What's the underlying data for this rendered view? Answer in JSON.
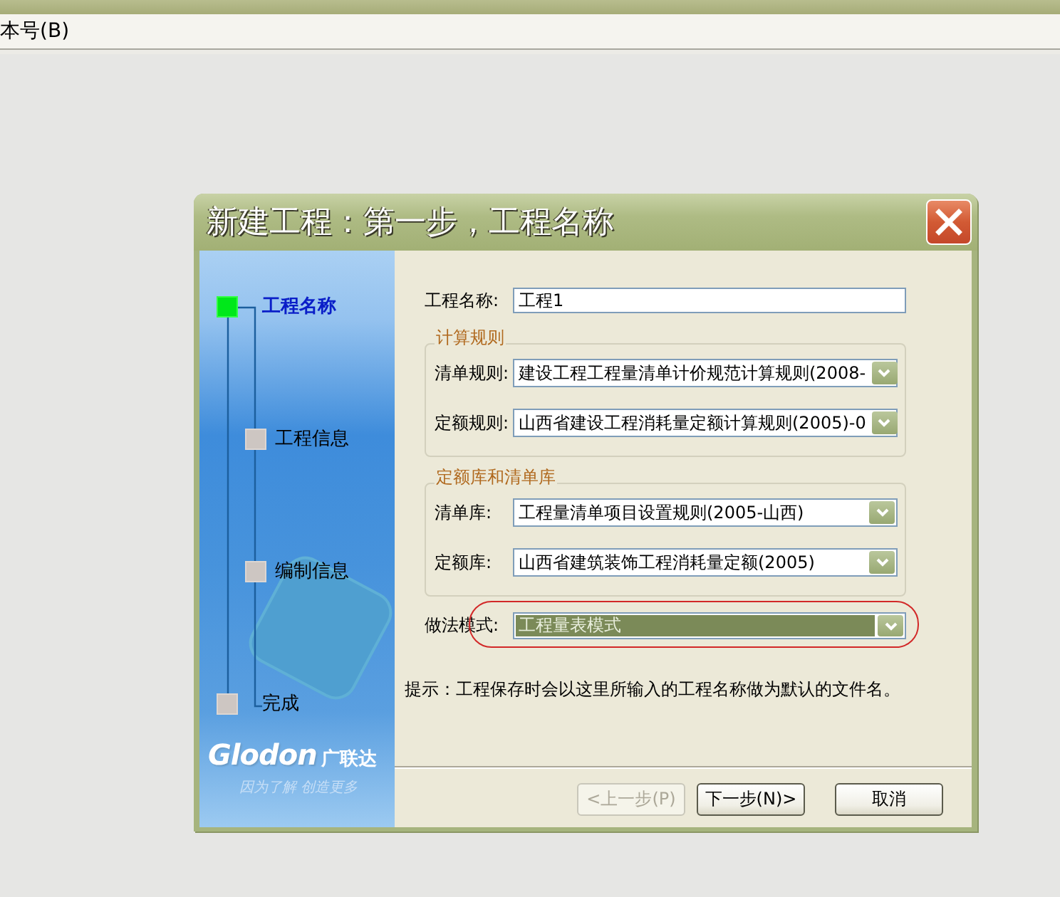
{
  "menu_bar": {
    "items": [
      {
        "label": "本号(B)"
      }
    ]
  },
  "dialog": {
    "title": "新建工程：第一步，工程名称",
    "steps": [
      {
        "label": "工程名称",
        "selected": true
      },
      {
        "label": "工程信息",
        "selected": false
      },
      {
        "label": "编制信息",
        "selected": false
      },
      {
        "label": "完成",
        "selected": false
      }
    ],
    "logo": {
      "brand": "Glodon",
      "brand_cn": "广联达",
      "tagline": "因为了解 创造更多"
    },
    "project_name": {
      "label": "工程名称:",
      "value": "工程1"
    },
    "groups": [
      {
        "legend": "计算规则",
        "fields": [
          {
            "label": "清单规则:",
            "value": "建设工程工程量清单计价规范计算规则(2008-",
            "highlighted": false
          },
          {
            "label": "定额规则:",
            "value": "山西省建设工程消耗量定额计算规则(2005)-0",
            "highlighted": false
          }
        ]
      },
      {
        "legend": "定额库和清单库",
        "fields": [
          {
            "label": "清单库:",
            "value": "工程量清单项目设置规则(2005-山西)",
            "highlighted": false
          },
          {
            "label": "定额库:",
            "value": "山西省建筑装饰工程消耗量定额(2005)",
            "highlighted": false
          }
        ]
      }
    ],
    "method": {
      "label": "做法模式:",
      "value": "工程量表模式",
      "highlighted": true,
      "circled": true
    },
    "hint": "提示：工程保存时会以这里所输入的工程名称做为默认的文件名。",
    "buttons": [
      {
        "label": "<上一步(P)",
        "disabled": true
      },
      {
        "label": "下一步(N)>",
        "disabled": false
      },
      {
        "label": "取消",
        "disabled": false
      }
    ]
  }
}
